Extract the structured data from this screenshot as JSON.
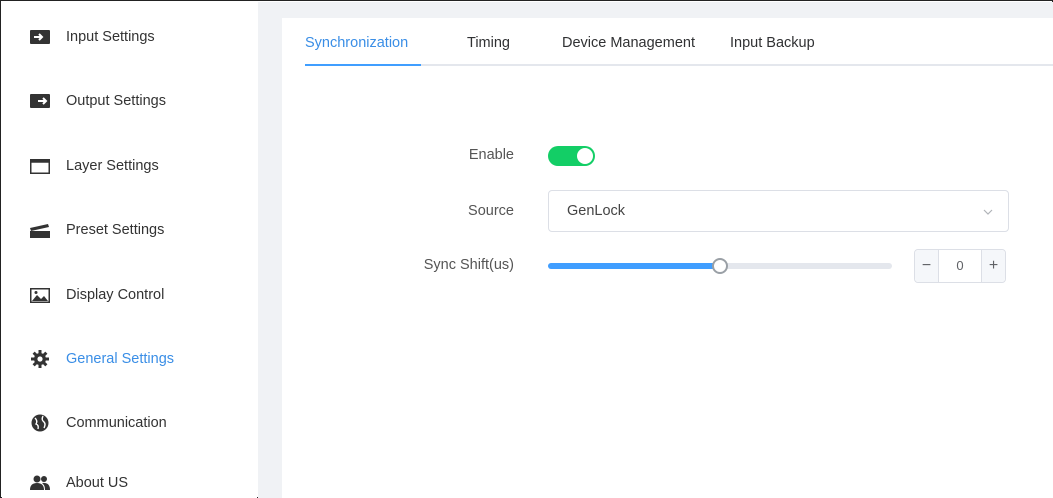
{
  "sidebar": {
    "items": [
      {
        "label": "Input Settings",
        "icon": "input-icon"
      },
      {
        "label": "Output Settings",
        "icon": "output-icon"
      },
      {
        "label": "Layer Settings",
        "icon": "window-icon"
      },
      {
        "label": "Preset Settings",
        "icon": "clapper-icon"
      },
      {
        "label": "Display Control",
        "icon": "image-icon"
      },
      {
        "label": "General Settings",
        "icon": "gear-icon",
        "active": true
      },
      {
        "label": "Communication",
        "icon": "globe-icon"
      },
      {
        "label": "About US",
        "icon": "users-icon"
      }
    ]
  },
  "tabs": [
    {
      "label": "Synchronization",
      "active": true
    },
    {
      "label": "Timing"
    },
    {
      "label": "Device Management"
    },
    {
      "label": "Input Backup"
    }
  ],
  "form": {
    "enable_label": "Enable",
    "enable_value": true,
    "source_label": "Source",
    "source_value": "GenLock",
    "sync_shift_label": "Sync Shift(us)",
    "sync_shift_slider_fraction": 0.5,
    "sync_shift_value": "0",
    "minus": "−",
    "plus": "+"
  },
  "colors": {
    "accent": "#409eff",
    "active_text": "#3a8ee6",
    "switch_on": "#13ce66",
    "gutter": "#f0f2f5"
  }
}
